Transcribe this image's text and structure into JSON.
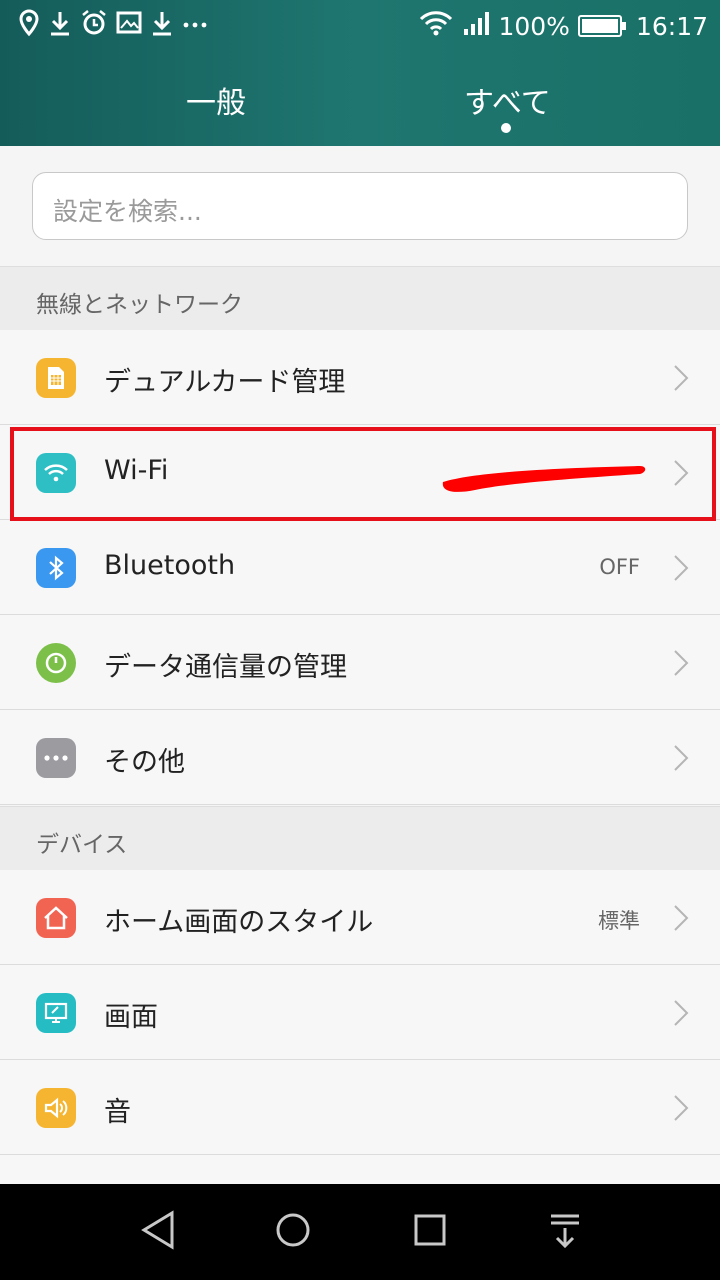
{
  "status_bar": {
    "left_icons": [
      "location-icon",
      "download-icon",
      "alarm-icon",
      "gallery-icon",
      "download-icon",
      "more-notifications-icon"
    ],
    "battery_percent": "100%",
    "time": "16:17"
  },
  "tabs": [
    {
      "label": "一般",
      "active": false
    },
    {
      "label": "すべて",
      "active": true
    }
  ],
  "search": {
    "placeholder": "設定を検索..."
  },
  "sections": [
    {
      "label": "無線とネットワーク",
      "items": [
        {
          "label": "デュアルカード管理",
          "value": "",
          "icon": "sim-card-icon",
          "color": "#f5b531"
        },
        {
          "label": "Wi-Fi",
          "value": "",
          "icon": "wifi-icon",
          "color": "#2ebfc4"
        },
        {
          "label": "Bluetooth",
          "value": "OFF",
          "icon": "bluetooth-icon",
          "color": "#3a98f0"
        },
        {
          "label": "データ通信量の管理",
          "value": "",
          "icon": "data-usage-icon",
          "color": "#7cc04a"
        },
        {
          "label": "その他",
          "value": "",
          "icon": "more-icon",
          "color": "#9b9ba0"
        }
      ]
    },
    {
      "label": "デバイス",
      "items": [
        {
          "label": "ホーム画面のスタイル",
          "value": "標準",
          "icon": "home-icon",
          "color": "#f26452"
        },
        {
          "label": "画面",
          "value": "",
          "icon": "display-icon",
          "color": "#26bcc4"
        },
        {
          "label": "音",
          "value": "",
          "icon": "sound-icon",
          "color": "#f5b531"
        }
      ]
    }
  ],
  "nav_bar": [
    "back-icon",
    "home-icon",
    "recents-icon",
    "notification-shade-icon"
  ]
}
